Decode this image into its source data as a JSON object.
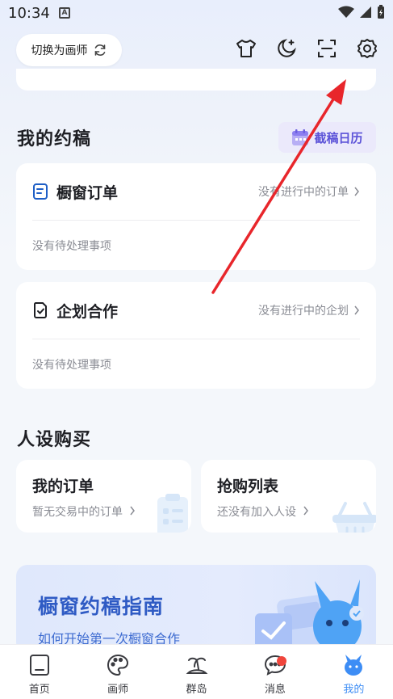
{
  "status_bar": {
    "time": "10:34",
    "notification_letter": "A"
  },
  "header": {
    "switch_label": "切换为画师",
    "icons": [
      "tshirt-icon",
      "moon-icon",
      "scan-icon",
      "gear-icon"
    ]
  },
  "my_commissions": {
    "title": "我的约稿",
    "calendar_label": "截稿日历",
    "cards": [
      {
        "title": "橱窗订单",
        "status": "没有进行中的订单",
        "note": "没有待处理事项"
      },
      {
        "title": "企划合作",
        "status": "没有进行中的企划",
        "note": "没有待处理事项"
      }
    ]
  },
  "character_purchase": {
    "title": "人设购买",
    "my_orders": {
      "title": "我的订单",
      "sub": "暂无交易中的订单"
    },
    "flash_list": {
      "title": "抢购列表",
      "sub": "还没有加入人设"
    }
  },
  "guide": {
    "title": "橱窗约稿指南",
    "sub": "如何开始第一次橱窗合作"
  },
  "bottom_nav": {
    "items": [
      {
        "label": "首页"
      },
      {
        "label": "画师"
      },
      {
        "label": "群岛"
      },
      {
        "label": "消息"
      },
      {
        "label": "我的"
      }
    ]
  },
  "colors": {
    "accent": "#3d8df5",
    "calendar_text": "#5b52d8",
    "guide_title": "#2f5bc4",
    "annotation_arrow": "#e8262b",
    "badge": "#f0453c"
  }
}
